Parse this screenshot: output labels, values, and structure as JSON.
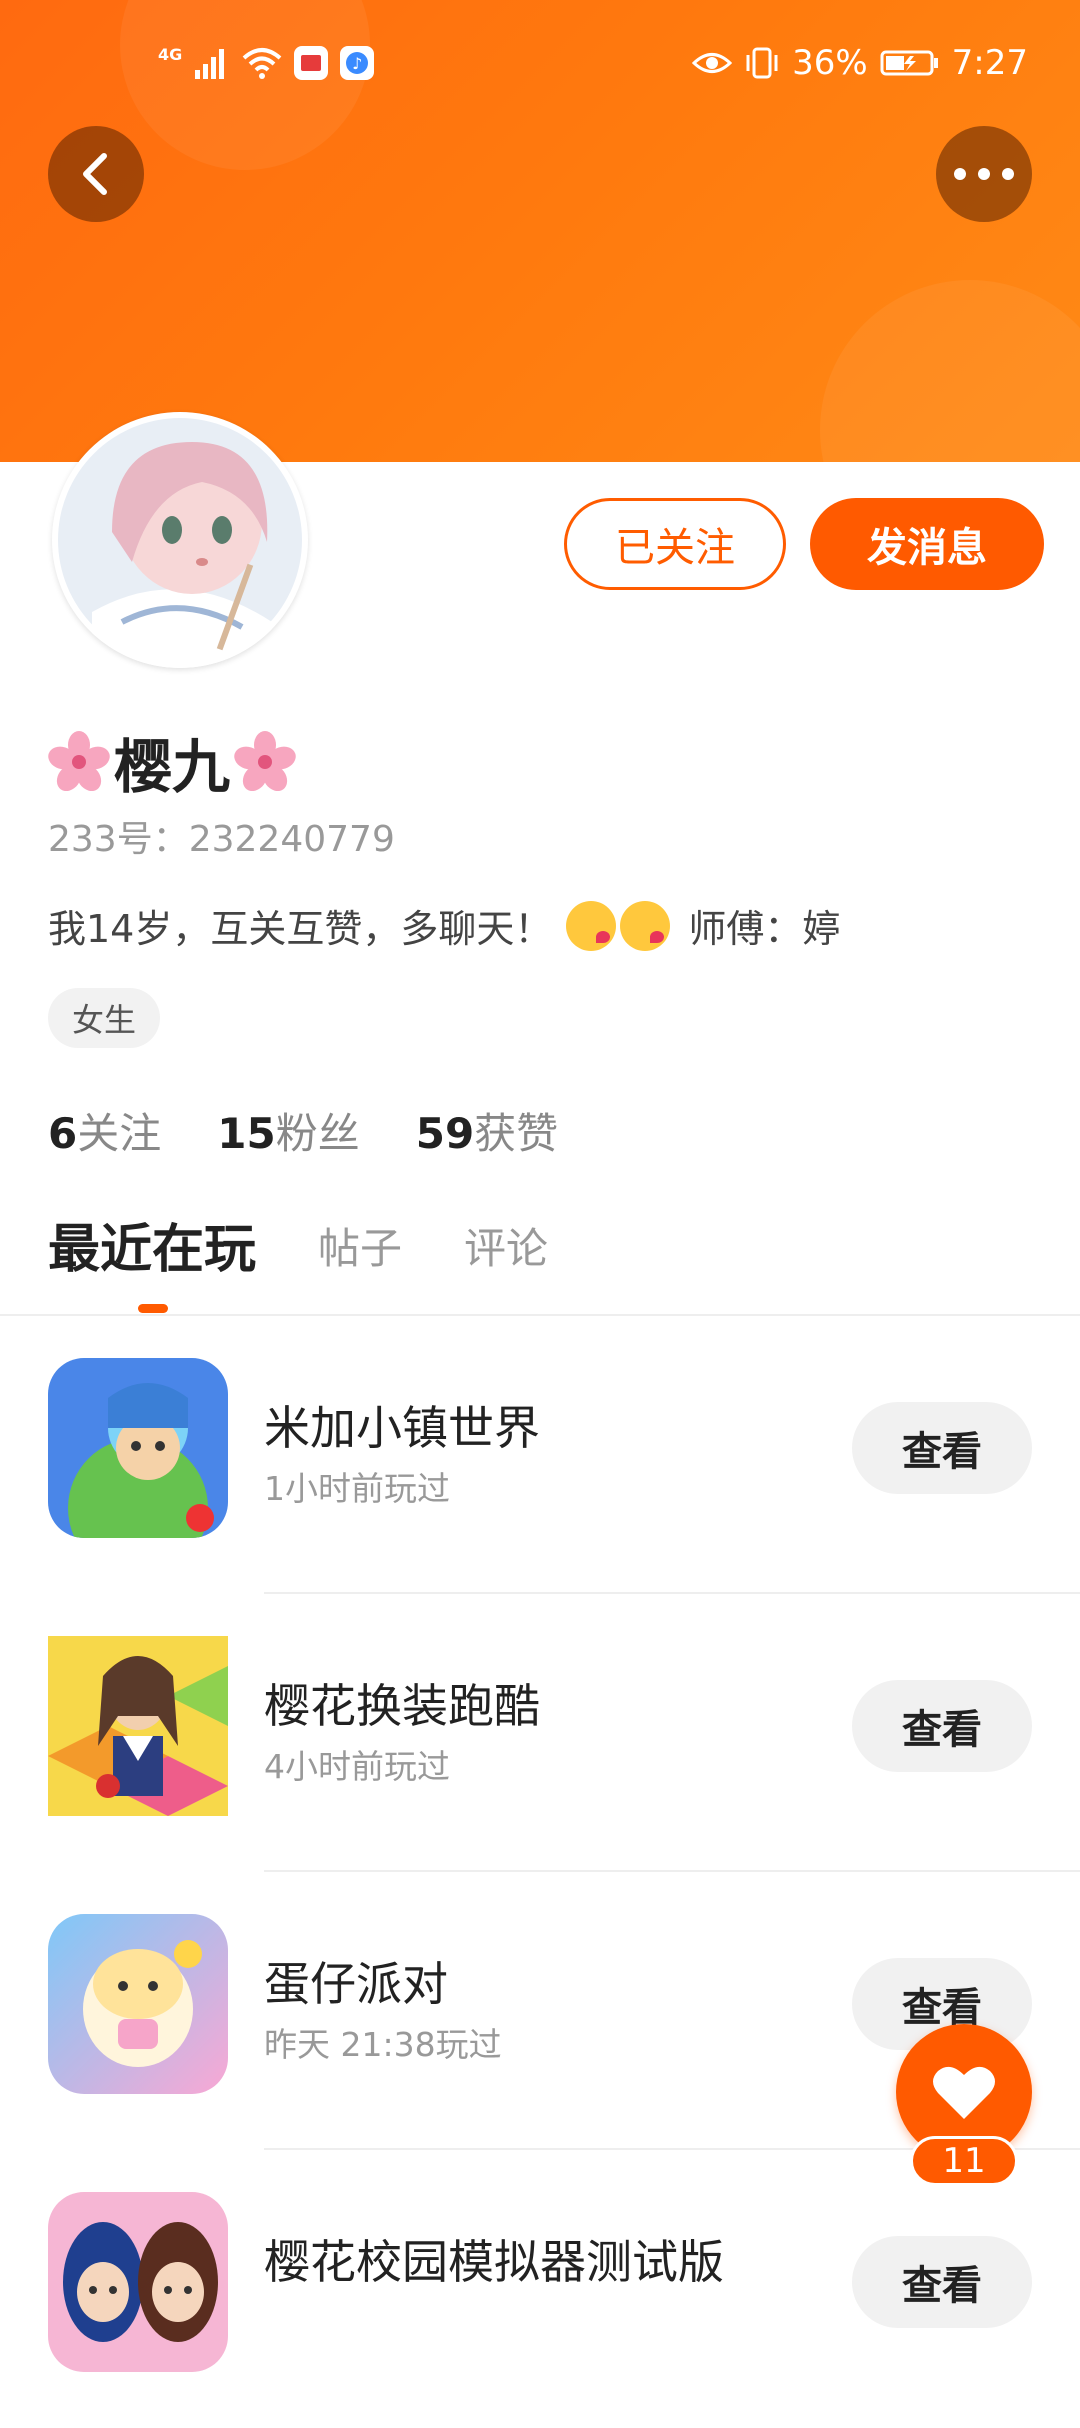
{
  "status_bar": {
    "network": "4G",
    "battery": "36%",
    "time": "7:27"
  },
  "header": {
    "back_icon": "chevron-left-icon",
    "more_icon": "more-dots-icon"
  },
  "profile": {
    "name": "樱九",
    "uid_label": "233号：",
    "uid_value": "232240779",
    "bio": "我14岁，互关互赞，多聊天！",
    "bio_suffix": "师傅：婷",
    "gender_tag": "女生",
    "follow_button": "已关注",
    "message_button": "发消息",
    "stats": {
      "following_count": "6",
      "following_label": "关注",
      "fans_count": "15",
      "fans_label": "粉丝",
      "likes_count": "59",
      "likes_label": "获赞"
    }
  },
  "tabs": [
    {
      "label": "最近在玩",
      "active": true
    },
    {
      "label": "帖子",
      "active": false
    },
    {
      "label": "评论",
      "active": false
    }
  ],
  "games": [
    {
      "title": "米加小镇世界",
      "subtitle": "1小时前玩过",
      "action": "查看"
    },
    {
      "title": "樱花换装跑酷",
      "subtitle": "4小时前玩过",
      "action": "查看"
    },
    {
      "title": "蛋仔派对",
      "subtitle": "昨天 21:38玩过",
      "action": "查看"
    },
    {
      "title": "樱花校园模拟器测试版",
      "subtitle": "",
      "action": "查看"
    }
  ],
  "fab": {
    "icon": "heart-icon",
    "count": "11"
  },
  "colors": {
    "accent": "#ff5a00",
    "header_gradient_start": "#ff6a10",
    "header_gradient_end": "#ff8a16"
  }
}
